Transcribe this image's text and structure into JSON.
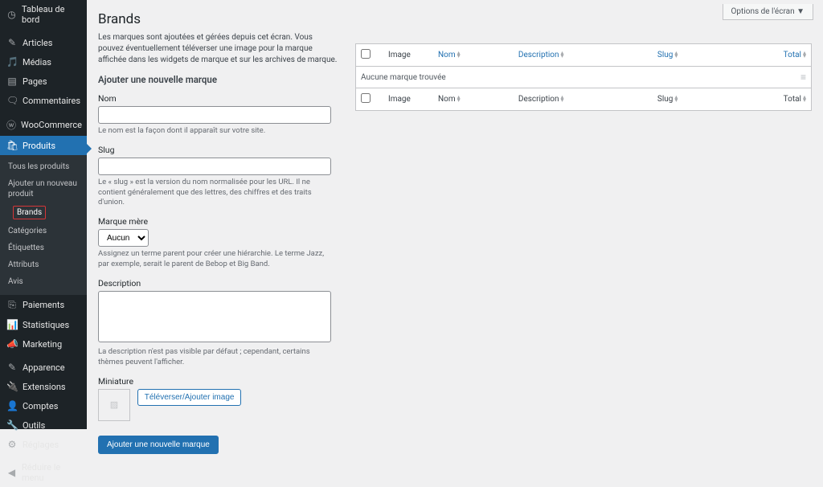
{
  "screen_options": "Options de l'écran  ▼",
  "page_title": "Brands",
  "intro": "Les marques sont ajoutées et gérées depuis cet écran. Vous pouvez éventuellement téléverser une image pour la marque affichée dans les widgets de marque et sur les archives de marque.",
  "add_title": "Ajouter une nouvelle marque",
  "fields": {
    "name_label": "Nom",
    "name_help": "Le nom est la façon dont il apparaît sur votre site.",
    "slug_label": "Slug",
    "slug_help": "Le « slug » est la version du nom normalisée pour les URL. Il ne contient généralement que des lettres, des chiffres et des traits d'union.",
    "parent_label": "Marque mère",
    "parent_value": "Aucun",
    "parent_help": "Assignez un terme parent pour créer une hiérarchie. Le terme Jazz, par exemple, serait le parent de Bebop et Big Band.",
    "description_label": "Description",
    "description_help": "La description n'est pas visible par défaut ; cependant, certains thèmes peuvent l'afficher.",
    "thumbnail_label": "Miniature",
    "upload_label": "Téléverser/Ajouter image",
    "submit_label": "Ajouter une nouvelle marque"
  },
  "table": {
    "cols": {
      "image": "Image",
      "name": "Nom",
      "description": "Description",
      "slug": "Slug",
      "total": "Total"
    },
    "empty": "Aucune marque trouvée"
  },
  "sidebar": {
    "main": [
      {
        "icon": "speed",
        "label": "Tableau de bord"
      },
      {
        "icon": "pin",
        "label": "Articles"
      },
      {
        "icon": "media",
        "label": "Médias"
      },
      {
        "icon": "page",
        "label": "Pages"
      },
      {
        "icon": "comment",
        "label": "Commentaires"
      }
    ],
    "woo": {
      "icon": "woo",
      "label": "WooCommerce"
    },
    "products": {
      "icon": "bag",
      "label": "Produits"
    },
    "submenu": [
      "Tous les produits",
      "Ajouter un nouveau produit",
      "Brands",
      "Catégories",
      "Étiquettes",
      "Attributs",
      "Avis"
    ],
    "woo2": [
      {
        "icon": "pay",
        "label": "Paiements"
      },
      {
        "icon": "stats",
        "label": "Statistiques"
      },
      {
        "icon": "mega",
        "label": "Marketing"
      }
    ],
    "admin": [
      {
        "icon": "brush",
        "label": "Apparence"
      },
      {
        "icon": "plug",
        "label": "Extensions"
      },
      {
        "icon": "user",
        "label": "Comptes"
      },
      {
        "icon": "tool",
        "label": "Outils"
      },
      {
        "icon": "gear",
        "label": "Réglages"
      }
    ],
    "collapse": {
      "icon": "collapse",
      "label": "Réduire le menu"
    }
  },
  "icons": {
    "speed": "◷",
    "pin": "✎",
    "media": "🎵",
    "page": "▤",
    "comment": "🗨",
    "woo": "ⓦ",
    "bag": "🛍",
    "pay": "⎘",
    "stats": "📊",
    "mega": "📣",
    "brush": "✎",
    "plug": "🔌",
    "user": "👤",
    "tool": "🔧",
    "gear": "⚙",
    "collapse": "◀",
    "placeholder": "▨"
  }
}
